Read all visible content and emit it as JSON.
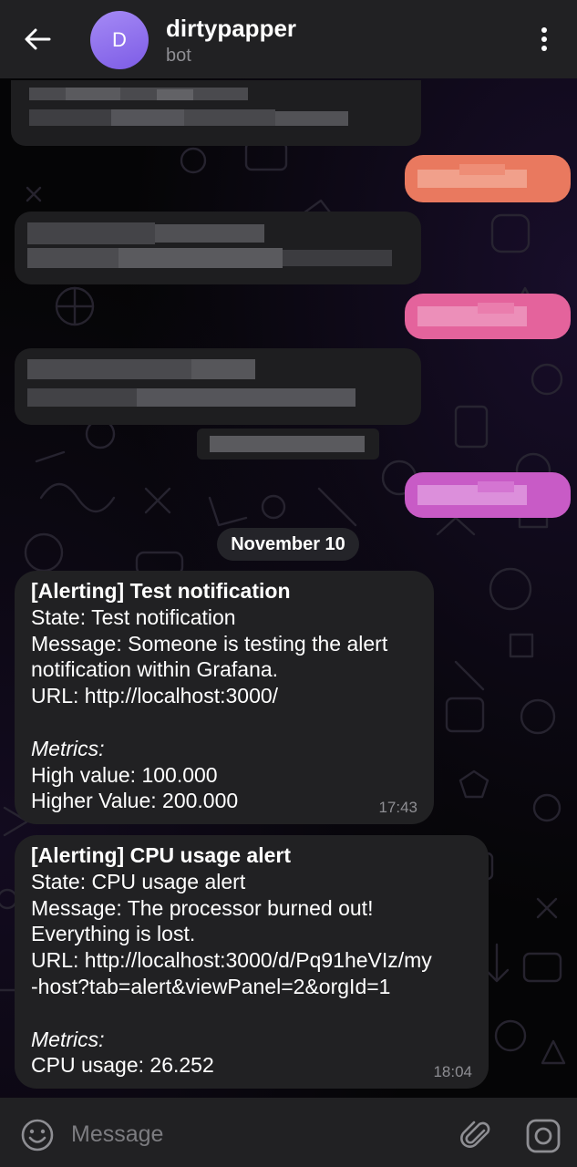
{
  "header": {
    "avatar_letter": "D",
    "title": "dirtypapper",
    "subtitle": "bot"
  },
  "date_separator": "November 10",
  "messages": [
    {
      "title": "[Alerting] Test notification",
      "lines": [
        "State: Test notification",
        "Message: Someone is testing the alert",
        "notification within Grafana.",
        "URL: http://localhost:3000/"
      ],
      "metrics_label": "Metrics:",
      "metrics": [
        "High value: 100.000",
        "Higher Value: 200.000"
      ],
      "time": "17:43"
    },
    {
      "title": "[Alerting] CPU usage alert",
      "lines": [
        "State: CPU usage alert",
        "Message: The processor burned out!",
        "Everything is lost.",
        "URL: http://localhost:3000/d/Pq91heVIz/my",
        "-host?tab=alert&viewPanel=2&orgId=1"
      ],
      "metrics_label": "Metrics:",
      "metrics": [
        "CPU usage: 26.252"
      ],
      "time": "18:04"
    }
  ],
  "input": {
    "placeholder": "Message"
  },
  "colors": {
    "header_bg": "#212123",
    "bubble_bg": "#212123",
    "avatar_gradient": [
      "#a58af5",
      "#7d5ce6"
    ],
    "outgoing_colors": [
      "#e9795f",
      "#e4639c",
      "#c85bc6"
    ],
    "meta_text": "#8e8e93"
  },
  "icons": [
    "back-arrow-icon",
    "more-vertical-icon",
    "emoji-icon",
    "paperclip-icon",
    "camera-icon"
  ]
}
